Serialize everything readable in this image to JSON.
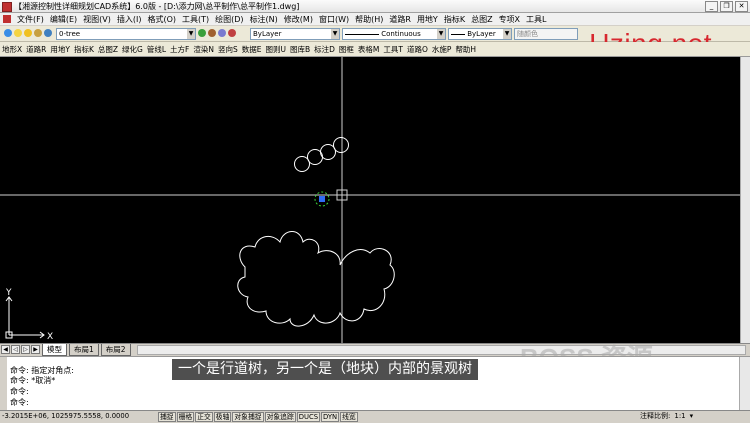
{
  "window": {
    "title": "【湘源控制性详细规划CAD系统】6.0版 - [D:\\添力网\\总平制作\\总平制作1.dwg]"
  },
  "menu": {
    "items": [
      "文件(F)",
      "编辑(E)",
      "视图(V)",
      "插入(I)",
      "格式(O)",
      "工具(T)",
      "绘图(D)",
      "标注(N)",
      "修改(M)",
      "窗口(W)",
      "帮助(H)",
      "道路R",
      "用地Y",
      "指标K",
      "总图Z",
      "专项X",
      "工具L"
    ]
  },
  "layer_toolbar": {
    "layer_name": "0-tree",
    "color": "ByLayer",
    "linetype": "Continuous",
    "lineweight": "ByLayer",
    "plotstyle": "随颜色"
  },
  "toolbar2": {
    "items": [
      "地形X",
      "道路R",
      "用地Y",
      "指标K",
      "总图Z",
      "绿化G",
      "管线L",
      "土方F",
      "渲染N",
      "竖向S",
      "数据E",
      "图则U",
      "图库B",
      "标注D",
      "图框",
      "表格M",
      "工具T",
      "道路O",
      "水施P",
      "帮助H"
    ]
  },
  "watermark": {
    "text": "Uzing.net"
  },
  "ucs": {
    "x_label": "X",
    "y_label": "Y"
  },
  "tabs": {
    "items": [
      "模型",
      "布局1",
      "布局2"
    ]
  },
  "command": {
    "line1": "命令: 指定对角点:",
    "line2": "命令: *取消*",
    "line3": "命令:",
    "line4": "命令:"
  },
  "subtitle": {
    "text": "一个是行道树，另一个是（地块）内部的景观树"
  },
  "boss_watermark": {
    "text": "BOSS 资源"
  },
  "status": {
    "coords": "-3.2015E+06, 1025975.5558, 0.0000",
    "toggles": [
      "捕捉",
      "栅格",
      "正交",
      "极轴",
      "对象捕捉",
      "对象追踪",
      "DUCS",
      "DYN",
      "线宽"
    ],
    "annotation_scale_label": "注释比例:",
    "annotation_scale_value": "1:1"
  }
}
